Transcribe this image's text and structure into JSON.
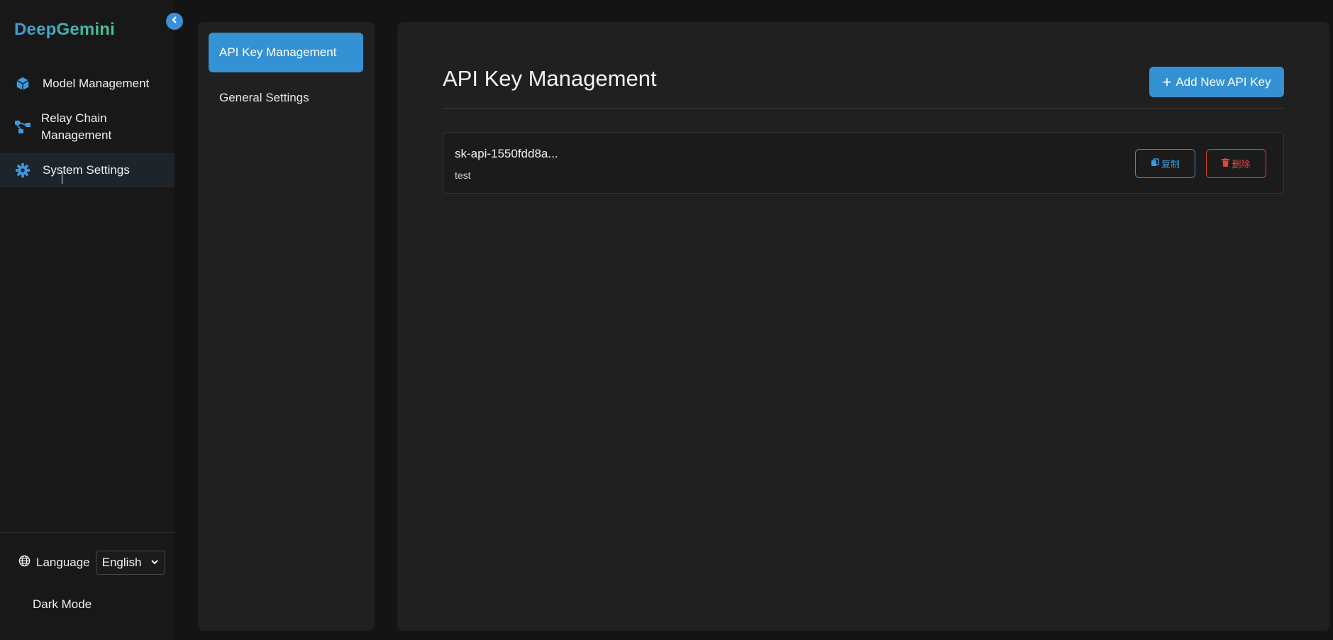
{
  "sidebar": {
    "logo": "DeepGemini",
    "items": [
      {
        "label": "Model Management",
        "icon": "cube-icon"
      },
      {
        "label": "Relay Chain\nManagement",
        "icon": "relay-chain-icon"
      },
      {
        "label": "System Settings",
        "icon": "gear-icon",
        "active": true
      }
    ],
    "language_label": "Language",
    "language_value": "English",
    "dark_mode_label": "Dark Mode"
  },
  "submenu": {
    "items": [
      {
        "label": "API Key Management",
        "active": true
      },
      {
        "label": "General Settings"
      }
    ]
  },
  "main": {
    "title": "API Key Management",
    "add_button": "Add New API Key",
    "keys": [
      {
        "name": "sk-api-1550fdd8a...",
        "description": "test",
        "copy_label": "复制",
        "delete_label": "删除"
      }
    ]
  },
  "colors": {
    "accent": "#3491d3",
    "danger": "#e0453e",
    "background": "#141414",
    "panel": "#202020"
  }
}
